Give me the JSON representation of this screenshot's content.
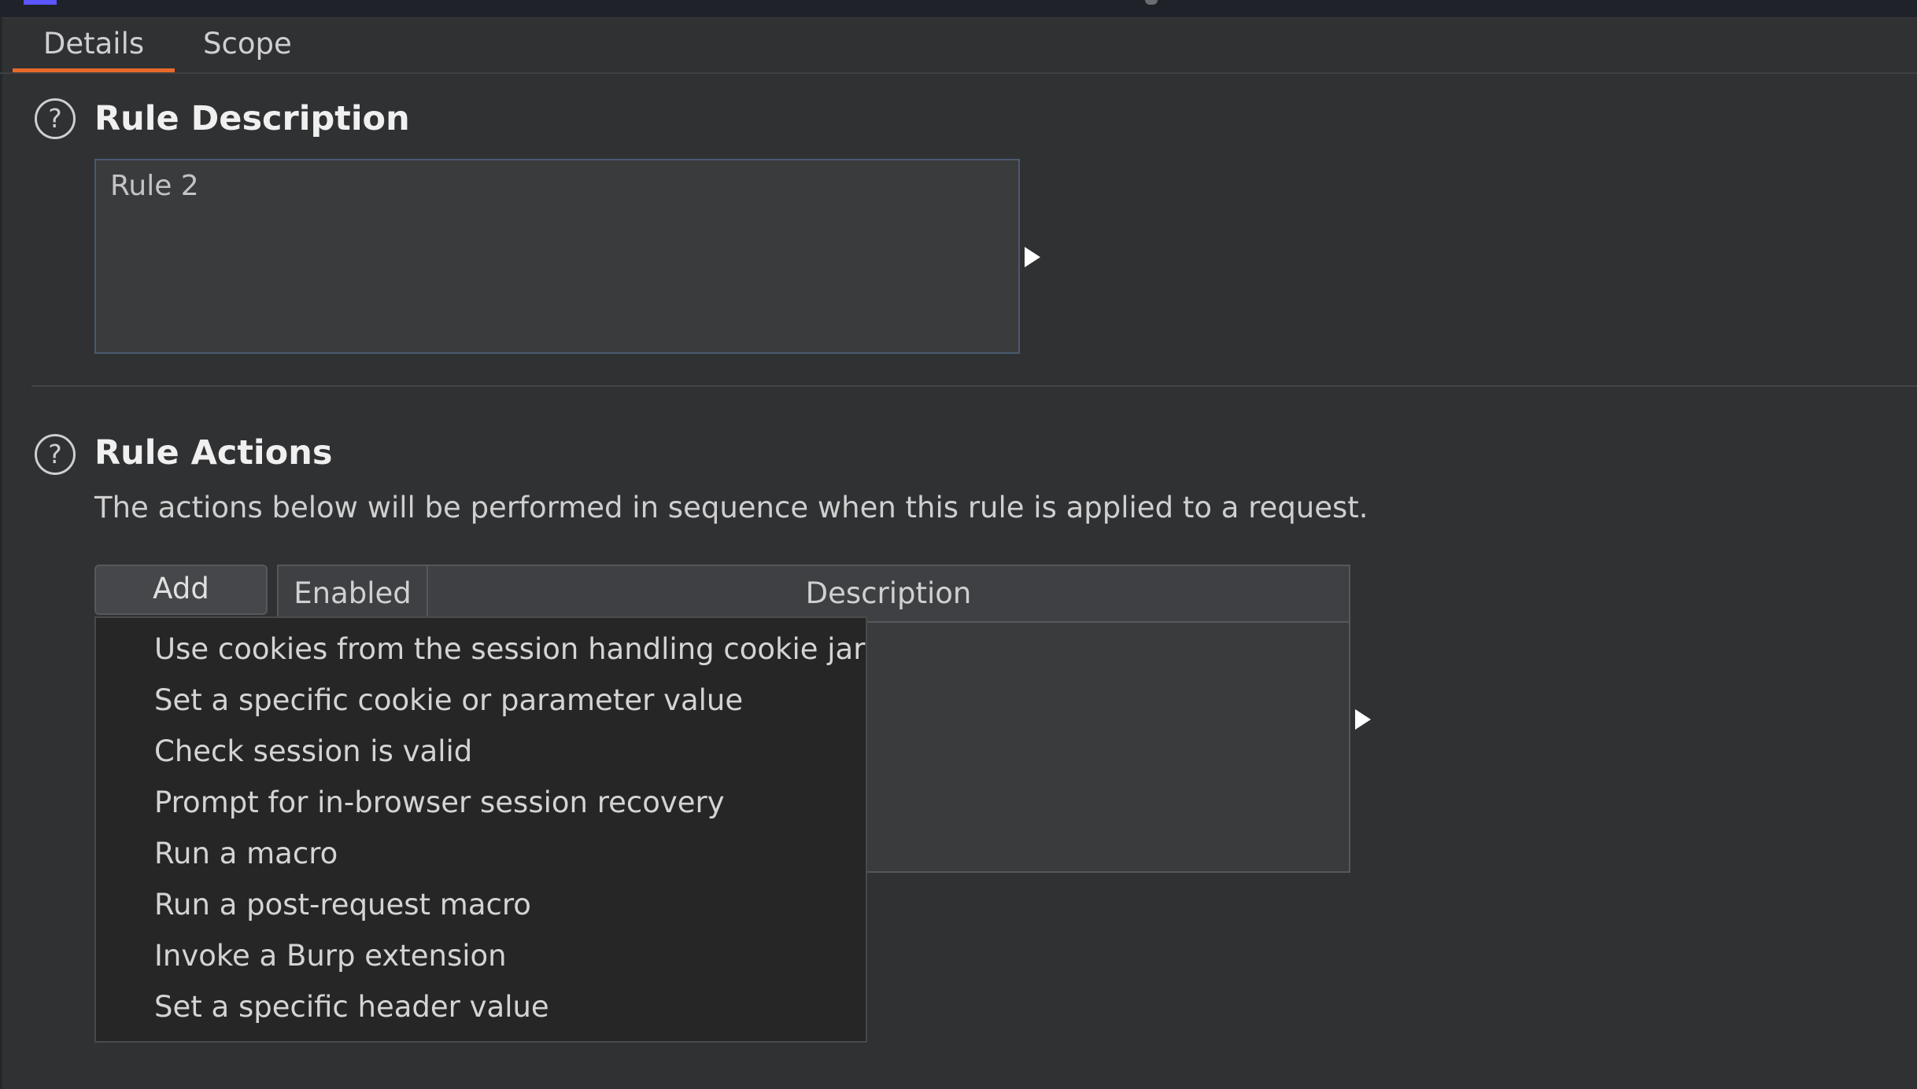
{
  "tabs": [
    {
      "label": "Details",
      "active": true
    },
    {
      "label": "Scope",
      "active": false
    }
  ],
  "accent_color": "#e8682a",
  "rule_description": {
    "title": "Rule Description",
    "value": "Rule 2",
    "help_icon": "?"
  },
  "rule_actions": {
    "title": "Rule Actions",
    "help_icon": "?",
    "info": "The actions below will be performed in sequence when this rule is applied to a request.",
    "add_button": "Add",
    "table": {
      "columns": [
        "Enabled",
        "Description"
      ]
    },
    "add_menu": [
      "Use cookies from the session handling cookie jar",
      "Set a specific cookie or parameter value",
      "Check session is valid",
      "Prompt for in-browser session recovery",
      "Run a macro",
      "Run a post-request macro",
      "Invoke a Burp extension",
      "Set a specific header value"
    ]
  }
}
